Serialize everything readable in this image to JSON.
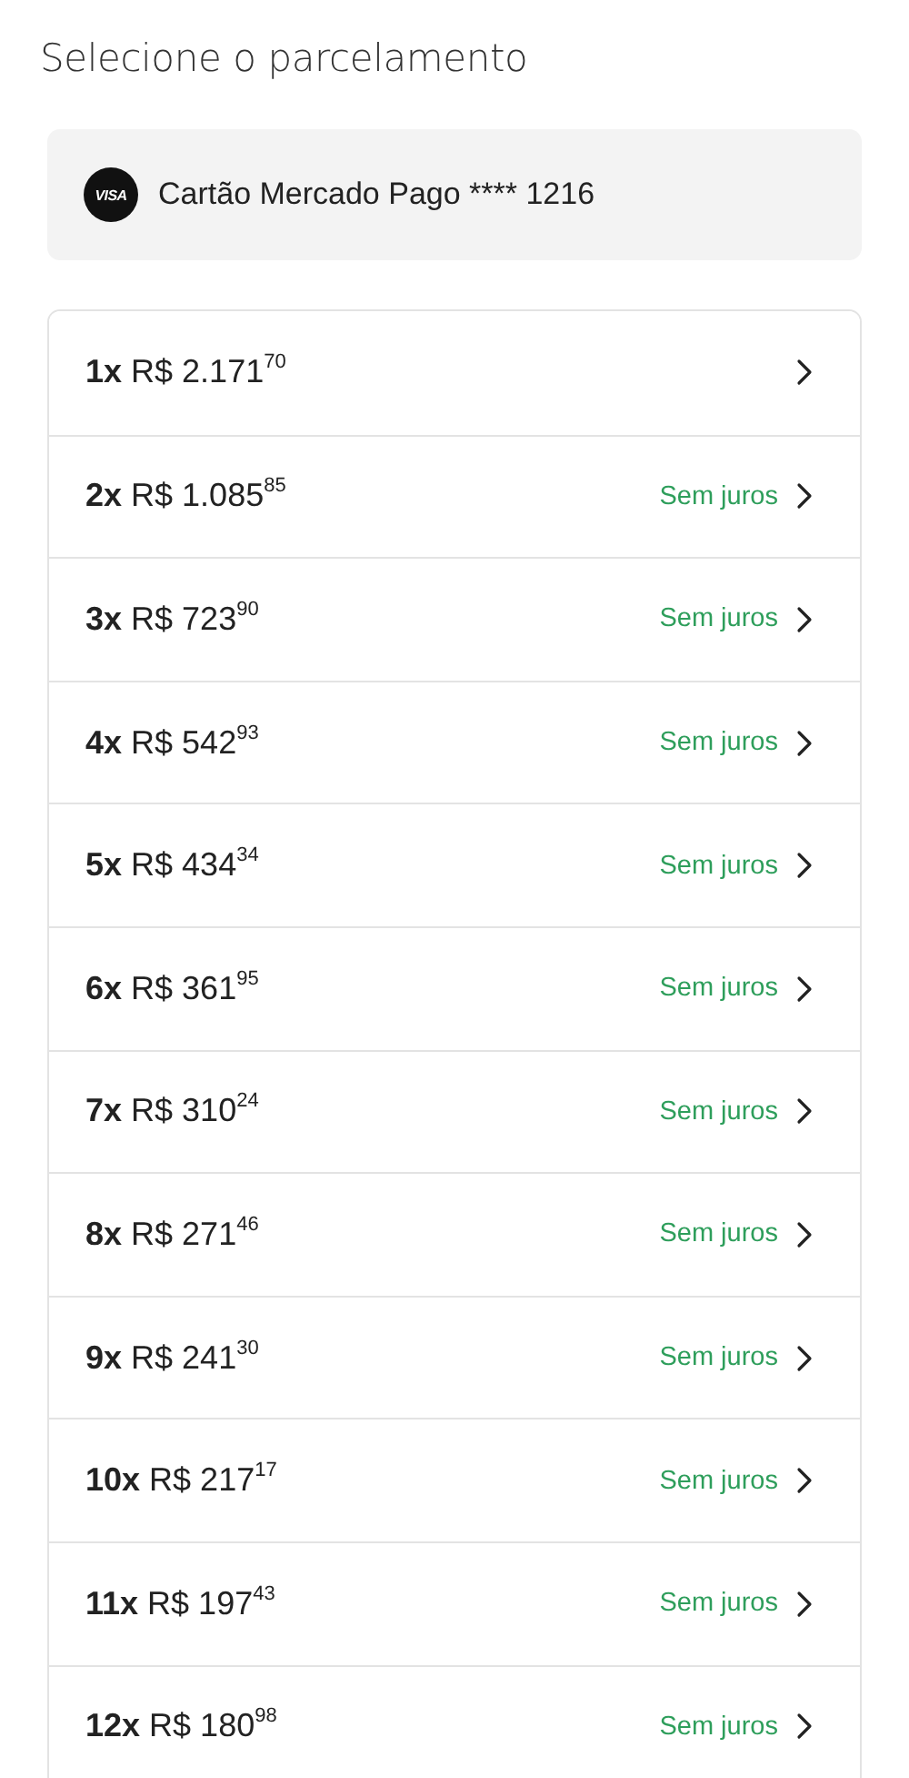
{
  "title": "Selecione o parcelamento",
  "card": {
    "brand": "VISA",
    "label": "Cartão Mercado Pago **** 1216"
  },
  "installments": [
    {
      "amount": "**1x** R$ 2.171$^{70}$"
    },
    {
      "amount": "**2x** R$ 1.085$^{85}$",
      "tag": "Sem juros"
    },
    {
      "amount": "**3x** R$ 723$^{90}$",
      "tag": "Sem juros"
    },
    {
      "amount": "**4x** R$ 542$^{93}$",
      "tag": "Sem juros"
    },
    {
      "amount": "**5x** R$ 434$^{34}$",
      "tag": "Sem juros"
    },
    {
      "amount": "**6x** R$ 361$^{95}$",
      "tag": "Sem juros"
    },
    {
      "amount": "**7x** R$ 310$^{24}$",
      "tag": "Sem juros"
    },
    {
      "amount": "**8x** R$ 271$^{46}$",
      "tag": "Sem juros"
    },
    {
      "amount": "**9x** R$ 241$^{30}$",
      "tag": "Sem juros"
    },
    {
      "amount": "**10x** R$ 217$^{17}$",
      "tag": "Sem juros"
    },
    {
      "amount": "**11x** R$ 197$^{43}$",
      "tag": "Sem juros"
    },
    {
      "amount": "**12x** R$ 180$^{98}$",
      "tag": "Sem juros"
    }
  ]
}
